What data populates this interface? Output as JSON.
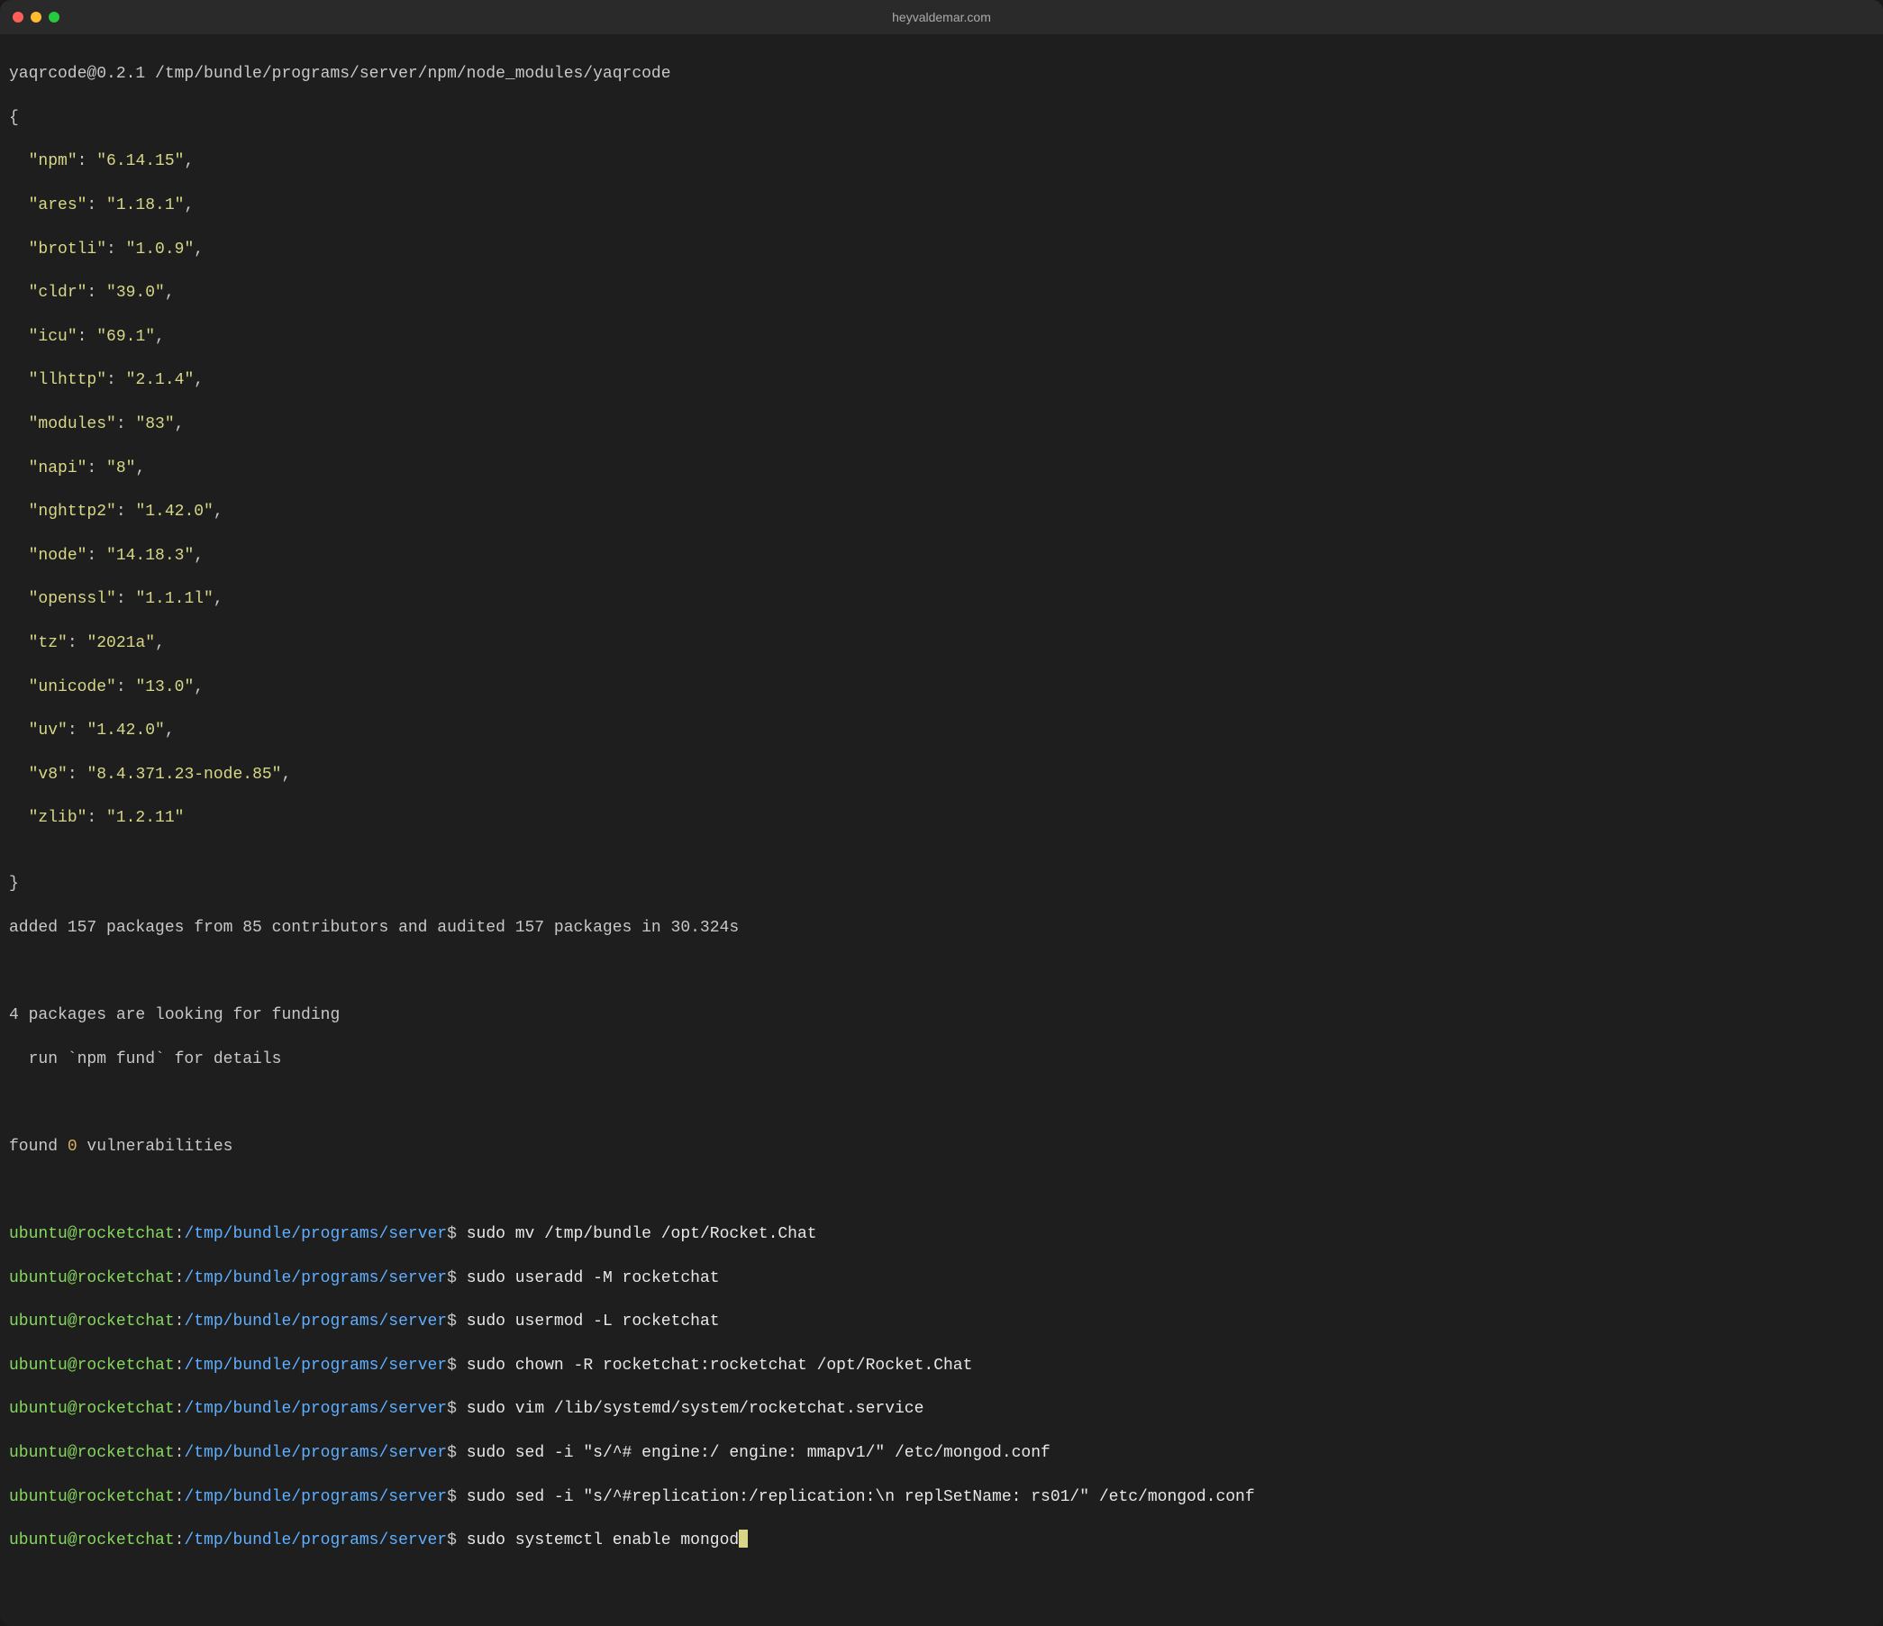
{
  "window": {
    "title": "heyvaldemar.com"
  },
  "output": {
    "pkg_header": "yaqrcode@0.2.1 /tmp/bundle/programs/server/npm/node_modules/yaqrcode",
    "brace_open": "{",
    "kv": [
      {
        "k": "\"npm\"",
        "v": "\"6.14.15\""
      },
      {
        "k": "\"ares\"",
        "v": "\"1.18.1\""
      },
      {
        "k": "\"brotli\"",
        "v": "\"1.0.9\""
      },
      {
        "k": "\"cldr\"",
        "v": "\"39.0\""
      },
      {
        "k": "\"icu\"",
        "v": "\"69.1\""
      },
      {
        "k": "\"llhttp\"",
        "v": "\"2.1.4\""
      },
      {
        "k": "\"modules\"",
        "v": "\"83\""
      },
      {
        "k": "\"napi\"",
        "v": "\"8\""
      },
      {
        "k": "\"nghttp2\"",
        "v": "\"1.42.0\""
      },
      {
        "k": "\"node\"",
        "v": "\"14.18.3\""
      },
      {
        "k": "\"openssl\"",
        "v": "\"1.1.1l\""
      },
      {
        "k": "\"tz\"",
        "v": "\"2021a\""
      },
      {
        "k": "\"unicode\"",
        "v": "\"13.0\""
      },
      {
        "k": "\"uv\"",
        "v": "\"1.42.0\""
      },
      {
        "k": "\"v8\"",
        "v": "\"8.4.371.23-node.85\""
      },
      {
        "k": "\"zlib\"",
        "v": "\"1.2.11\""
      }
    ],
    "brace_close": "}",
    "added_line_pre": "added 157 packages from 85 contributors and audited 157 packages in 30.324s",
    "blank": "",
    "funding1": "4 packages are looking for funding",
    "funding2": "  run `npm fund` for details",
    "vuln_pre": "found ",
    "vuln_num": "0",
    "vuln_post": " vulnerabilities"
  },
  "prompt": {
    "user_host": "ubuntu@rocketchat",
    "colon": ":",
    "path": "/tmp/bundle/programs/server",
    "sigil": "$ "
  },
  "commands": [
    "sudo mv /tmp/bundle /opt/Rocket.Chat",
    "sudo useradd -M rocketchat",
    "sudo usermod -L rocketchat",
    "sudo chown -R rocketchat:rocketchat /opt/Rocket.Chat",
    "sudo vim /lib/systemd/system/rocketchat.service",
    "sudo sed -i \"s/^# engine:/ engine: mmapv1/\" /etc/mongod.conf",
    "sudo sed -i \"s/^#replication:/replication:\\n replSetName: rs01/\" /etc/mongod.conf",
    "sudo systemctl enable mongod"
  ]
}
